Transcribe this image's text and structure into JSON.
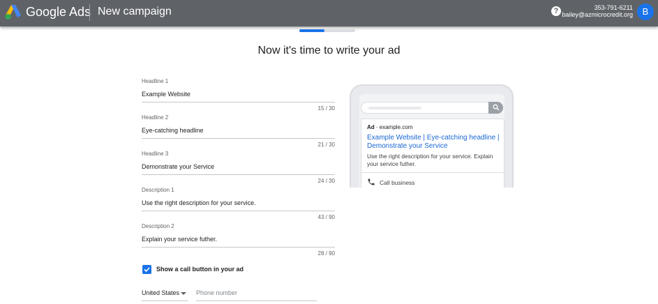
{
  "header": {
    "brand": "Google Ads",
    "title": "New campaign",
    "help": "?",
    "phone": "353-791-6211",
    "email": "bailey@azmicrocredit.org",
    "avatar_letter": "B"
  },
  "progress": {
    "fraction": 0.45
  },
  "heading": "Now it's time to write your ad",
  "fields": [
    {
      "label": "Headline 1",
      "value": "Example Website",
      "count": "15 / 30"
    },
    {
      "label": "Headline 2",
      "value": "Eye-catching headline",
      "count": "21 / 30"
    },
    {
      "label": "Headline 3",
      "value": "Demonstrate your Service",
      "count": "24 / 30"
    },
    {
      "label": "Description 1",
      "value": "Use the right description for your service.",
      "count": "43 / 90"
    },
    {
      "label": "Description 2",
      "value": "Explain your service futher.",
      "count": "28 / 90"
    }
  ],
  "call_button": {
    "label": "Show a call button in your ad",
    "checked": true
  },
  "country": {
    "value": "United States"
  },
  "phone_field": {
    "placeholder": "Phone number"
  },
  "preview": {
    "ad_badge": "Ad",
    "domain": "example.com",
    "title": "Example Website | Eye-catching headline | Demonstrate your Service",
    "description": "Use the right description for your service. Explain your service futher.",
    "call_label": "Call business"
  },
  "colors": {
    "accent": "#1a73e8",
    "topbar": "#5f6368",
    "link": "#1967d2"
  }
}
